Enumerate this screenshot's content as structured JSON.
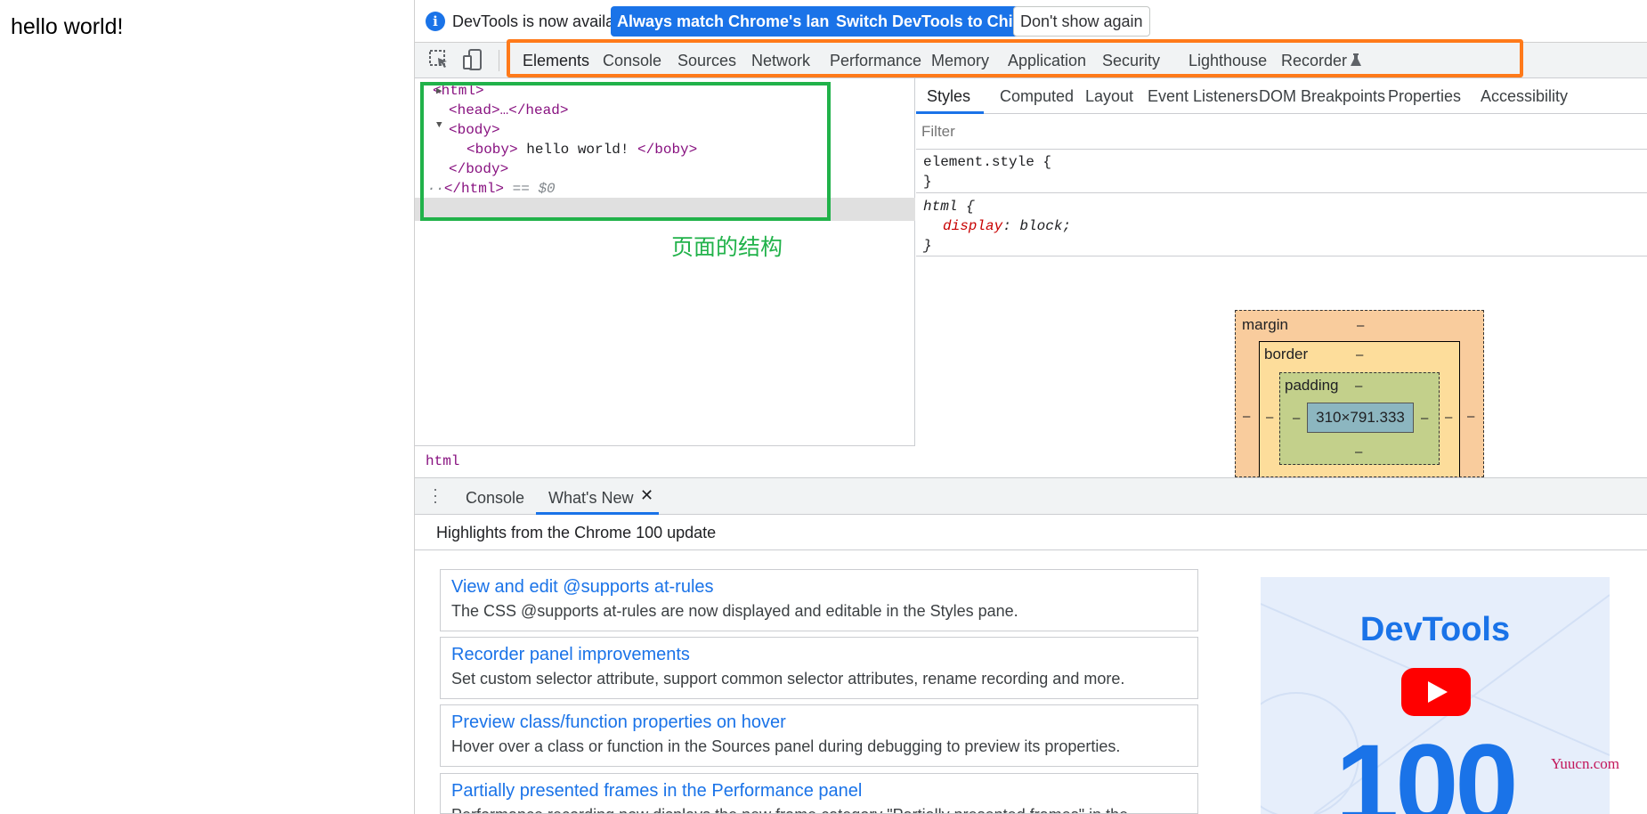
{
  "page": {
    "text": "hello world!"
  },
  "infobar": {
    "message": "DevTools is now available in Chinese!",
    "btn_match": "Always match Chrome's language",
    "btn_switch": "Switch DevTools to Chinese",
    "btn_dismiss": "Don't show again"
  },
  "main_tabs": [
    "Elements",
    "Console",
    "Sources",
    "Network",
    "Performance",
    "Memory",
    "Application",
    "Security",
    "Lighthouse",
    "Recorder"
  ],
  "elements": {
    "html_open": "<html>",
    "head": "<head>…</head>",
    "body_open": "<body>",
    "boby_open": "<boby>",
    "boby_text": " hello world! ",
    "boby_close": "</boby>",
    "body_close": "</body>",
    "html_close": "</html>",
    "dollar": " == $0",
    "annotation": "页面的结构",
    "breadcrumb": "html"
  },
  "style_tabs": [
    "Styles",
    "Computed",
    "Layout",
    "Event Listeners",
    "DOM Breakpoints",
    "Properties",
    "Accessibility"
  ],
  "styles": {
    "filter_placeholder": "Filter",
    "element_style_selector": "element.style {",
    "close_brace": "}",
    "html_selector": "html {",
    "prop_name": "display",
    "prop_value": "block;"
  },
  "box_model": {
    "margin_label": "margin",
    "border_label": "border",
    "padding_label": "padding",
    "dash": "–",
    "content_size": "310×791.333"
  },
  "drawer": {
    "tabs": [
      "Console",
      "What's New"
    ],
    "close": "✕",
    "header": "Highlights from the Chrome 100 update",
    "cards": [
      {
        "title": "View and edit @supports at-rules",
        "desc": "The CSS @supports at-rules are now displayed and editable in the Styles pane."
      },
      {
        "title": "Recorder panel improvements",
        "desc": "Set custom selector attribute, support common selector attributes, rename recording and more."
      },
      {
        "title": "Preview class/function properties on hover",
        "desc": "Hover over a class or function in the Sources panel during debugging to preview its properties."
      },
      {
        "title": "Partially presented frames in the Performance panel",
        "desc": "Performance recording now displays the new frame category \"Partially presented frames\" in the"
      }
    ],
    "promo_title": "DevTools",
    "promo_number": "100"
  },
  "watermark": "Yuucn.com",
  "colors": {
    "accent": "#1a73e8",
    "annotation_green": "#21b24a",
    "annotation_orange": "#ff7a1a",
    "tag": "#881280"
  }
}
